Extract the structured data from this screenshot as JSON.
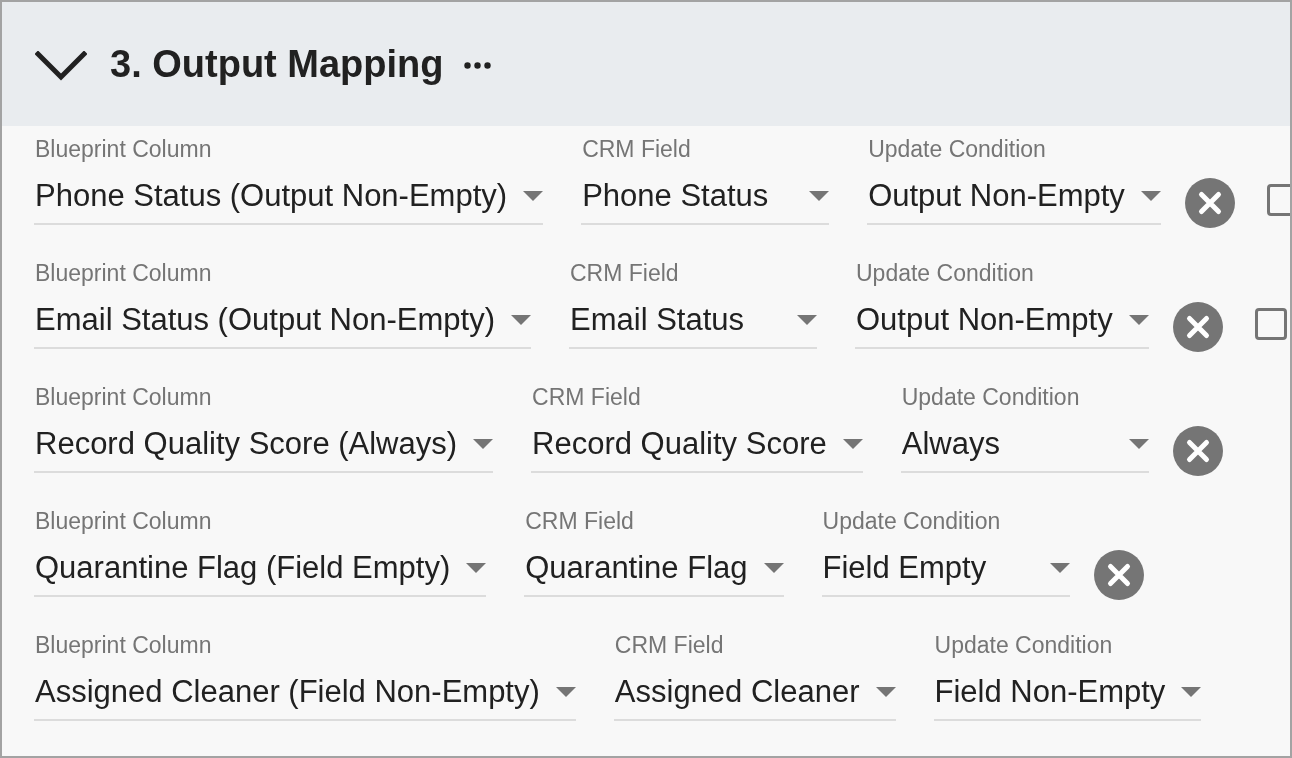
{
  "section": {
    "title": "3. Output Mapping",
    "expanded": true
  },
  "mappings": [
    {
      "fields": [
        {
          "label": "Blueprint Column",
          "value": "Phone Status (Output Non-Empty)"
        },
        {
          "label": "CRM Field",
          "value": "Phone Status"
        },
        {
          "label": "Update Condition",
          "value": "Output Non-Empty"
        }
      ],
      "removable": true,
      "checkbox": {
        "checked": false
      }
    },
    {
      "fields": [
        {
          "label": "Blueprint Column",
          "value": "Email Status (Output Non-Empty)"
        },
        {
          "label": "CRM Field",
          "value": "Email Status"
        },
        {
          "label": "Update Condition",
          "value": "Output Non-Empty"
        }
      ],
      "removable": true,
      "checkbox": {
        "checked": false
      }
    },
    {
      "fields": [
        {
          "label": "Blueprint Column",
          "value": "Record Quality Score (Always)"
        },
        {
          "label": "CRM Field",
          "value": "Record Quality Score"
        },
        {
          "label": "Update Condition",
          "value": "Always"
        }
      ],
      "removable": true
    },
    {
      "fields": [
        {
          "label": "Blueprint Column",
          "value": "Quarantine Flag (Field Empty)"
        },
        {
          "label": "CRM Field",
          "value": "Quarantine Flag"
        },
        {
          "label": "Update Condition",
          "value": "Field Empty"
        }
      ],
      "removable": true
    },
    {
      "fields": [
        {
          "label": "Blueprint Column",
          "value": "Assigned Cleaner (Field Non-Empty)"
        },
        {
          "label": "CRM Field",
          "value": "Assigned Cleaner"
        },
        {
          "label": "Update Condition",
          "value": "Field Non-Empty"
        }
      ]
    }
  ]
}
